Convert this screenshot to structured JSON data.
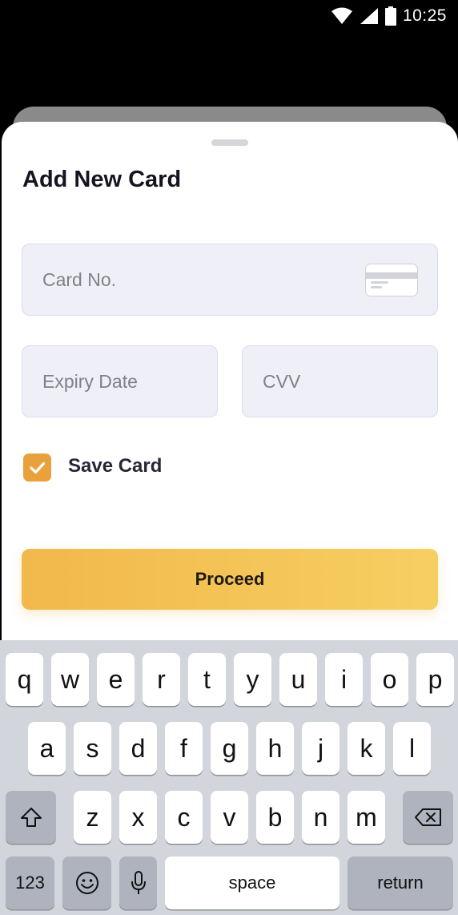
{
  "status_bar": {
    "time": "10:25",
    "icons": [
      "wifi-icon",
      "cellular-signal-icon",
      "battery-icon"
    ]
  },
  "sheet": {
    "title": "Add New Card",
    "card_number": {
      "placeholder": "Card No.",
      "value": "",
      "icon": "credit-card-icon"
    },
    "expiry": {
      "placeholder": "Expiry Date",
      "value": ""
    },
    "cvv": {
      "placeholder": "CVV",
      "value": ""
    },
    "save_card": {
      "label": "Save Card",
      "checked": true
    },
    "proceed_label": "Proceed"
  },
  "keyboard": {
    "row1": [
      "q",
      "w",
      "e",
      "r",
      "t",
      "y",
      "u",
      "i",
      "o",
      "p"
    ],
    "row2": [
      "a",
      "s",
      "d",
      "f",
      "g",
      "h",
      "j",
      "k",
      "l"
    ],
    "row3": [
      "z",
      "x",
      "c",
      "v",
      "b",
      "n",
      "m"
    ],
    "numbers_label": "123",
    "space_label": "space",
    "return_label": "return",
    "icons": [
      "shift-icon",
      "backspace-icon",
      "emoji-icon",
      "microphone-icon"
    ]
  },
  "colors": {
    "accent": "#E9A13B",
    "button_start": "#F2B84B",
    "button_end": "#F6CF62",
    "field_bg": "#EFF0F7"
  }
}
